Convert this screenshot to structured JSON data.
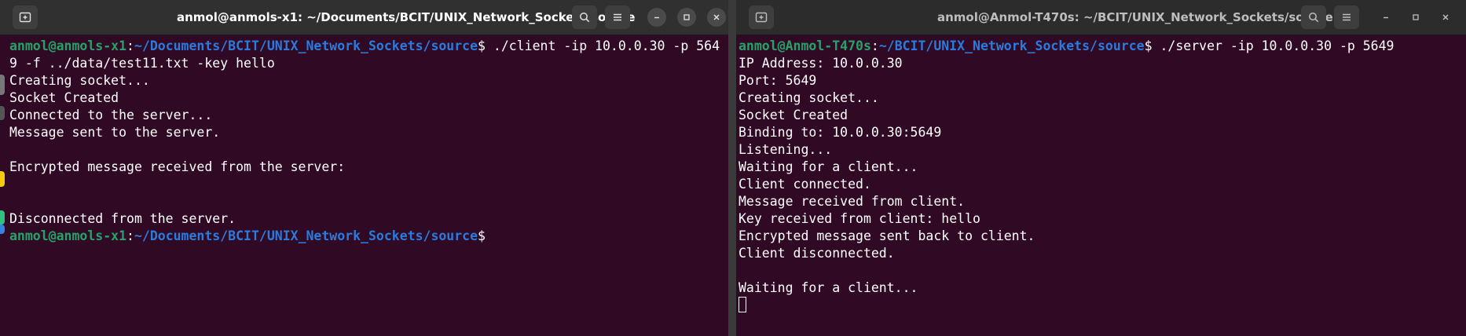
{
  "left_window": {
    "title": "anmol@anmols-x1: ~/Documents/BCIT/UNIX_Network_Sockets/source",
    "prompt_user": "anmol@anmols-x1",
    "prompt_path": "~/Documents/BCIT/UNIX_Network_Sockets/source",
    "prompt_symbol": "$",
    "command_line_1": " ./client -ip 10.0.0.30 -p 564",
    "command_line_2": "9 -f ../data/test11.txt -key hello",
    "output": [
      "Creating socket...",
      "Socket Created",
      "Connected to the server...",
      "Message sent to the server.",
      "",
      "Encrypted message received from the server:",
      "",
      "",
      "Disconnected from the server."
    ],
    "final_prompt_user": "anmol@anmols-x1",
    "final_prompt_path": "~/Documents/BCIT/UNIX_Network_Sockets/source",
    "final_prompt_symbol": "$"
  },
  "right_window": {
    "title": "anmol@Anmol-T470s: ~/BCIT/UNIX_Network_Sockets/source",
    "prompt_user": "anmol@Anmol-T470s",
    "prompt_path": "~/BCIT/UNIX_Network_Sockets/source",
    "prompt_symbol": "$",
    "command": " ./server -ip 10.0.0.30 -p 5649",
    "output": [
      "IP Address: 10.0.0.30",
      "Port: 5649",
      "Creating socket...",
      "Socket Created",
      "Binding to: 10.0.0.30:5649",
      "Listening...",
      "Waiting for a client...",
      "Client connected.",
      "Message received from client.",
      "Key received from client: hello",
      "Encrypted message sent back to client.",
      "Client disconnected.",
      "",
      "Waiting for a client..."
    ]
  },
  "colors": {
    "terminal_bg": "#300a24",
    "prompt_user": "#26a269",
    "prompt_path": "#2a7bde",
    "text": "#ffffff"
  },
  "icons": [
    "new-tab-icon",
    "search-icon",
    "hamburger-menu-icon",
    "minimize-icon",
    "maximize-icon",
    "close-icon"
  ]
}
